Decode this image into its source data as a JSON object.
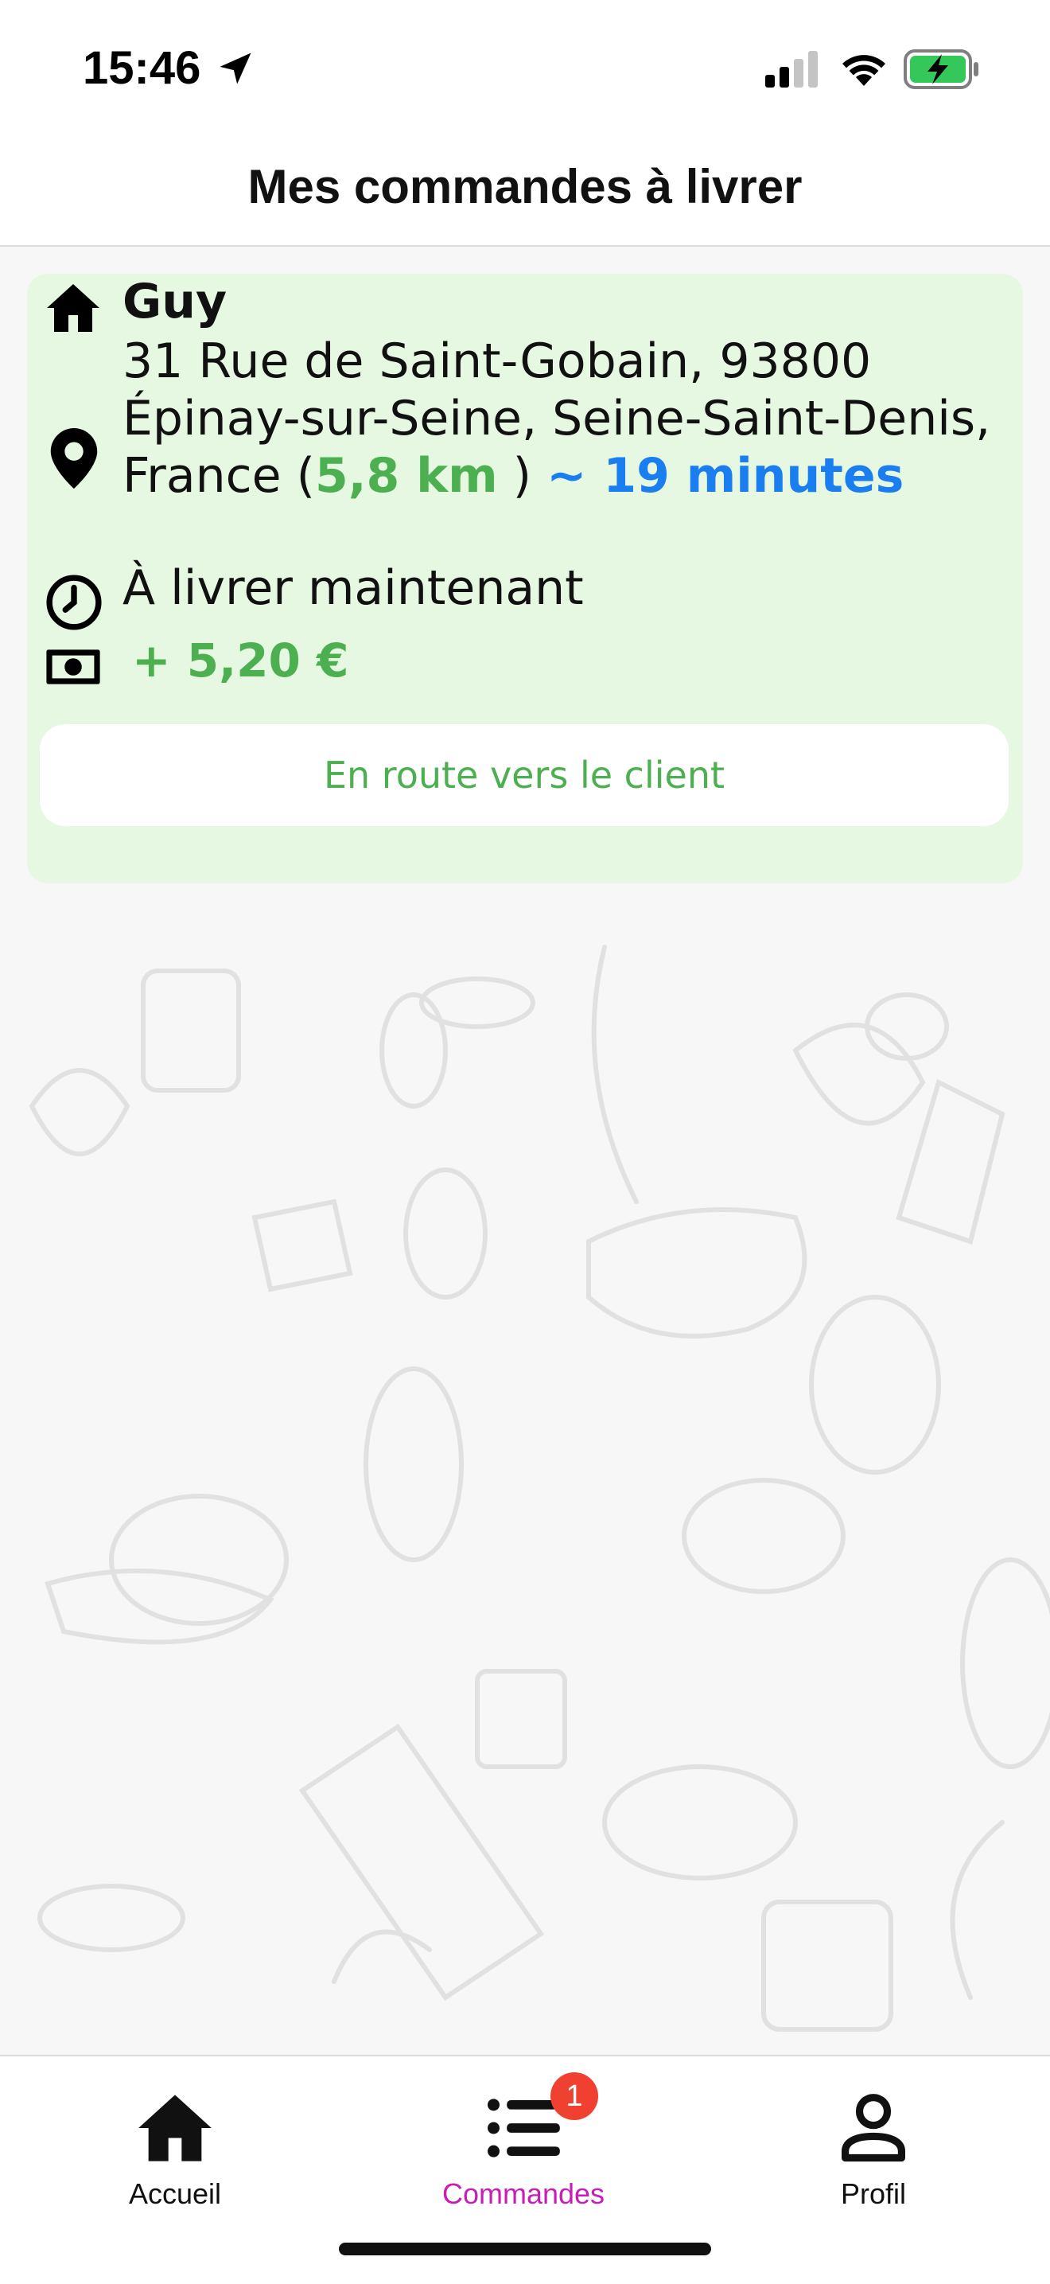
{
  "status_bar": {
    "time": "15:46",
    "icons": [
      "location-arrow-icon",
      "signal-icon",
      "wifi-icon",
      "battery-charging-icon"
    ]
  },
  "header": {
    "title": "Mes commandes à livrer"
  },
  "order": {
    "customer_name": "Guy",
    "address": "31 Rue de Saint-Gobain, 93800 Épinay-sur-Seine, Seine-Saint-Denis, France (",
    "distance": "5,8 km",
    "distance_close": " ) ",
    "eta": "~ 19 minutes",
    "delivery_time": "À livrer maintenant",
    "earnings": "+ 5,20 €",
    "status_button": "En route vers le client",
    "icons": [
      "home-icon",
      "map-pin-icon",
      "clock-icon",
      "money-icon"
    ]
  },
  "tabs": [
    {
      "label": "Accueil",
      "icon": "home-icon",
      "active": false
    },
    {
      "label": "Commandes",
      "icon": "list-icon",
      "active": true,
      "badge": "1"
    },
    {
      "label": "Profil",
      "icon": "person-icon",
      "active": false
    }
  ],
  "colors": {
    "card_background": "#e6f8e2",
    "green": "#4caf50",
    "blue": "#1a7ef0",
    "active_tab": "#c81eb3",
    "badge": "#f0402f"
  }
}
